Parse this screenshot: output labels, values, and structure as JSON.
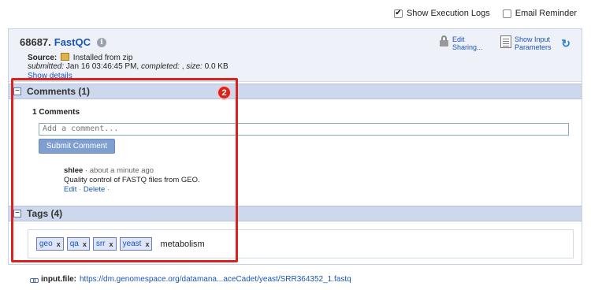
{
  "topbar": {
    "execution_logs": {
      "label": "Show Execution Logs",
      "checked": true
    },
    "email_reminder": {
      "label": "Email Reminder",
      "checked": false
    }
  },
  "job": {
    "id": "68687.",
    "tool": "FastQC",
    "source_label": "Source:",
    "source_value": "Installed from zip",
    "submitted_label": "submitted:",
    "submitted_value": "Jan 16 03:46:45 PM,",
    "completed_label": "completed:",
    "completed_value": ",",
    "size_label": "size:",
    "size_value": "0.0 KB",
    "show_details": "Show details"
  },
  "header_actions": {
    "edit_sharing": [
      "Edit",
      "Sharing..."
    ],
    "show_input": [
      "Show Input",
      "Parameters"
    ]
  },
  "comments": {
    "section_title": "Comments (1)",
    "count_label": "1 Comments",
    "input_placeholder": "Add a comment...",
    "submit_label": "Submit Comment",
    "items": [
      {
        "author": "shlee",
        "time": " · about a minute ago",
        "text": "Quality control of FASTQ files from GEO.",
        "edit": "Edit",
        "delete": "Delete",
        "separator": "·"
      }
    ]
  },
  "tags": {
    "section_title": "Tags (4)",
    "items": [
      "geo",
      "qa",
      "srr",
      "yeast"
    ],
    "remove_glyph": "x",
    "untagged": "metabolism"
  },
  "annotation": {
    "badge": "2"
  },
  "input_file": {
    "label": "input.file:",
    "url": "https://dm.genomespace.org/datamana...aceCadet/yeast/SRR364352_1.fastq"
  },
  "colors": {
    "highlight_red": "#d9231f",
    "link_blue": "#1a55b8",
    "section_header": "#cdd8ec"
  }
}
